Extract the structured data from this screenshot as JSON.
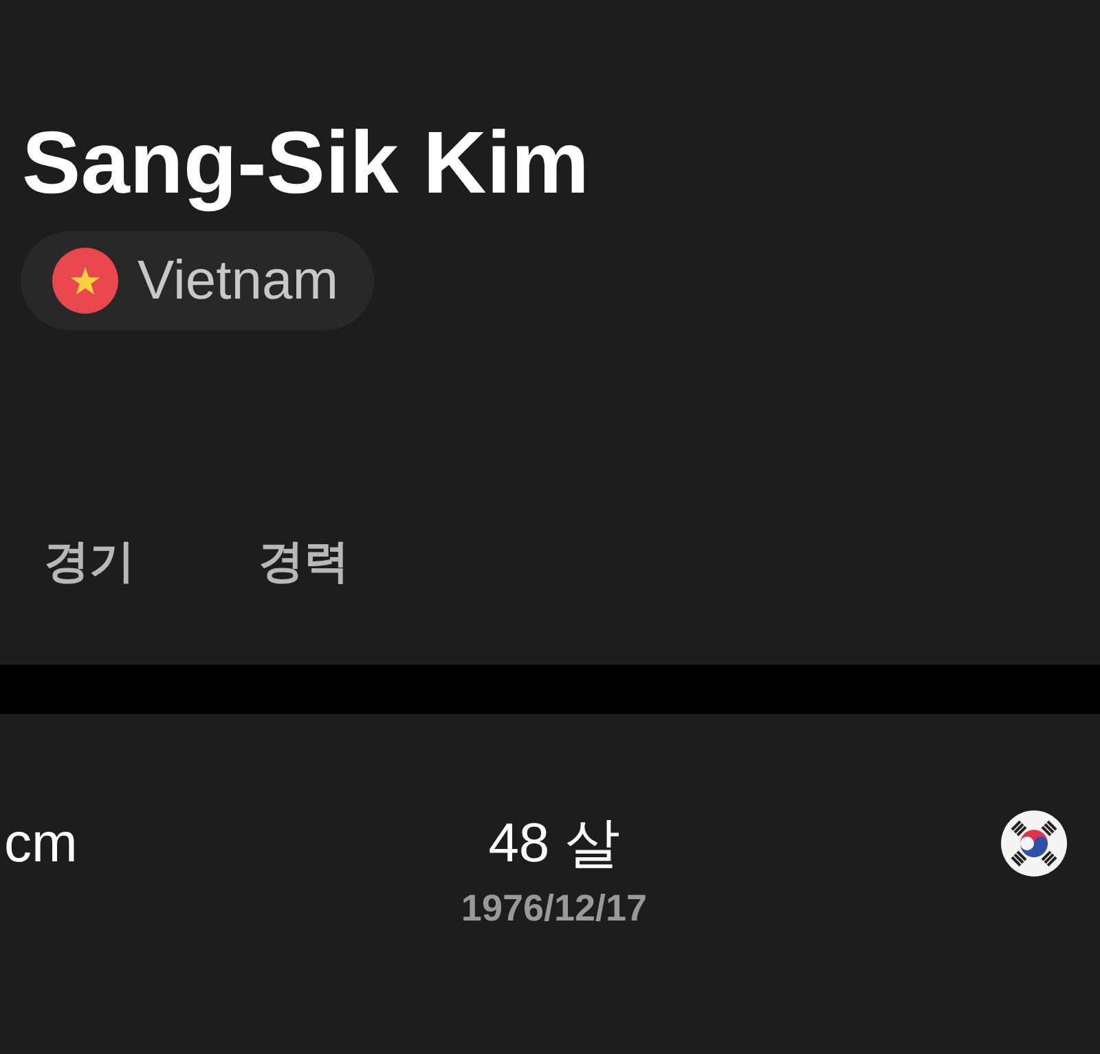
{
  "player": {
    "name": "Sang-Sik Kim",
    "team": "Vietnam"
  },
  "tabs": [
    {
      "label": "경기",
      "selected": false
    },
    {
      "label": "경력",
      "selected": false
    }
  ],
  "stats": {
    "height_unit": "cm",
    "age": "48 살",
    "birth_date": "1976/12/17"
  }
}
